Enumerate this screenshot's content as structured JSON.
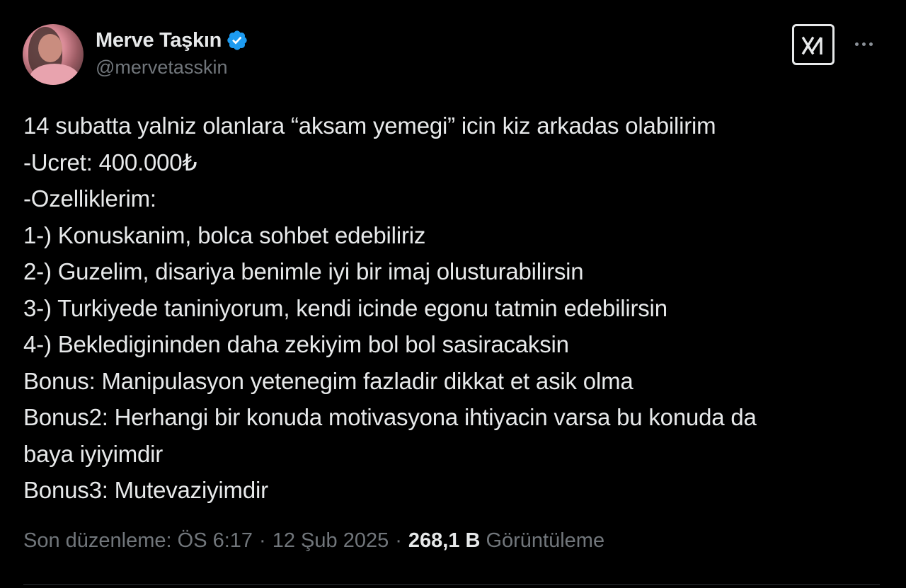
{
  "author": {
    "display_name": "Merve Taşkın",
    "handle": "@mervetasskin",
    "verified_color": "#1d9bf0"
  },
  "header_actions": {
    "grok_icon": "grok-icon",
    "more_icon": "more-horizontal-icon"
  },
  "tweet": {
    "lines": [
      "14 subatta yalniz olanlara “aksam yemegi” icin kiz arkadas olabilirim",
      "-Ucret: 400.000₺",
      "-Ozelliklerim:",
      "1-) Konuskanim, bolca sohbet edebiliriz",
      "2-) Guzelim, disariya benimle iyi bir imaj olusturabilirsin",
      "3-) Turkiyede taniniyorum, kendi icinde egonu tatmin edebilirsin",
      "4-) Bekledigininden daha zekiyim bol bol sasiracaksin",
      "Bonus: Manipulasyon yetenegim fazladir dikkat et asik olma",
      "Bonus2: Herhangi bir konuda motivasyona ihtiyacin varsa bu konuda da",
      "baya iyiyimdir",
      "Bonus3: Mutevaziyimdir"
    ]
  },
  "meta": {
    "edited_time": "Son düzenleme: ÖS 6:17",
    "separator": "·",
    "date": "12 Şub 2025",
    "views_count": "268,1 B",
    "views_label": "Görüntüleme"
  },
  "colors": {
    "background": "#000000",
    "text_primary": "#e7e9ea",
    "text_secondary": "#71767b",
    "divider": "#2f3336"
  }
}
